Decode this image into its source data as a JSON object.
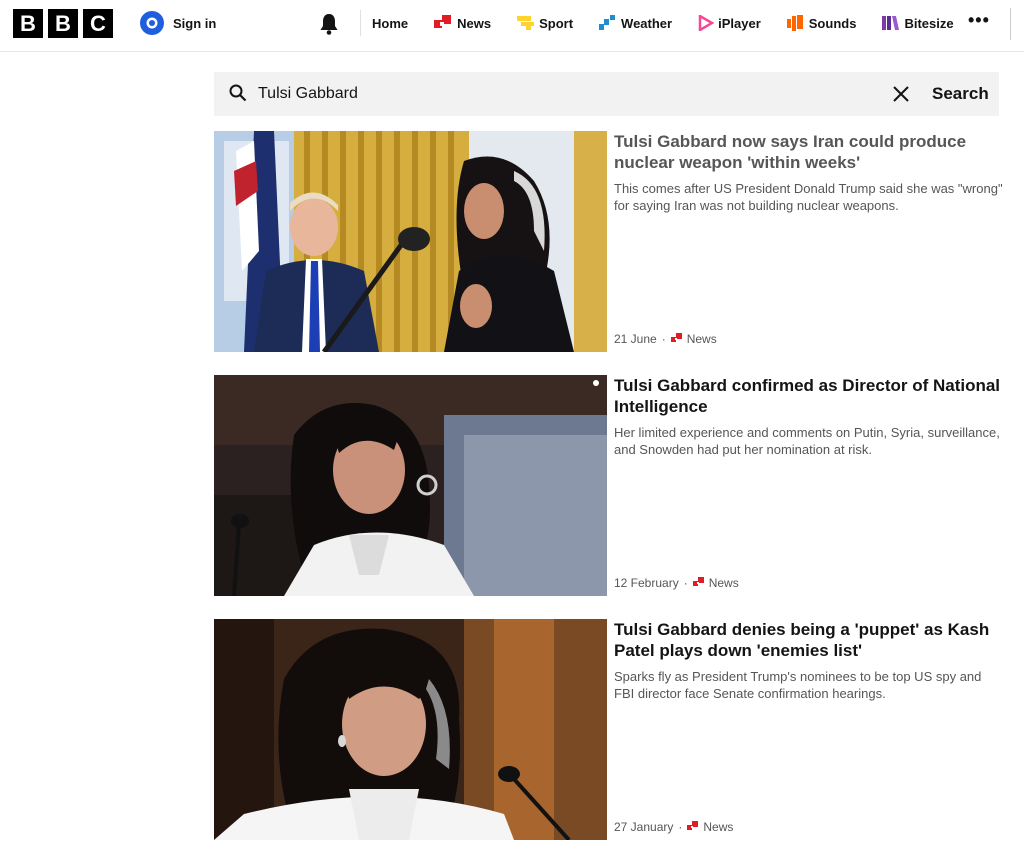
{
  "header": {
    "logo_letters": [
      "B",
      "B",
      "C"
    ],
    "signin_label": "Sign in",
    "nav": [
      {
        "label": "Home",
        "icon": "none"
      },
      {
        "label": "News",
        "icon": "news-icon",
        "color": "#e31b23"
      },
      {
        "label": "Sport",
        "icon": "sport-icon",
        "color": "#ffd230"
      },
      {
        "label": "Weather",
        "icon": "weather-icon",
        "color": "#1f8ccf"
      },
      {
        "label": "iPlayer",
        "icon": "iplayer-icon",
        "color": "#f54997"
      },
      {
        "label": "Sounds",
        "icon": "sounds-icon",
        "color": "#ff6600"
      },
      {
        "label": "Bitesize",
        "icon": "bitesize-icon",
        "color": "#7f3aa8"
      }
    ],
    "more_label": "•••"
  },
  "search": {
    "query": "Tulsi Gabbard",
    "button_label": "Search"
  },
  "results": [
    {
      "headline": "Tulsi Gabbard now says Iran could produce nuclear weapon 'within weeks'",
      "summary": "This comes after US President Donald Trump said she was \"wrong\" for saying Iran was not building nuclear weapons.",
      "date": "21 June",
      "section": "News"
    },
    {
      "headline": "Tulsi Gabbard confirmed as Director of National Intelligence",
      "summary": "Her limited experience and comments on Putin, Syria, surveillance, and Snowden had put her nomination at risk.",
      "date": "12 February",
      "section": "News"
    },
    {
      "headline": "Tulsi Gabbard denies being a 'puppet' as Kash Patel plays down 'enemies list'",
      "summary": "Sparks fly as President Trump's nominees to be top US spy and FBI director face Senate confirmation hearings.",
      "date": "27 January",
      "section": "News"
    }
  ],
  "colors": {
    "news_red": "#e31b23",
    "meta_grey": "#545658"
  }
}
